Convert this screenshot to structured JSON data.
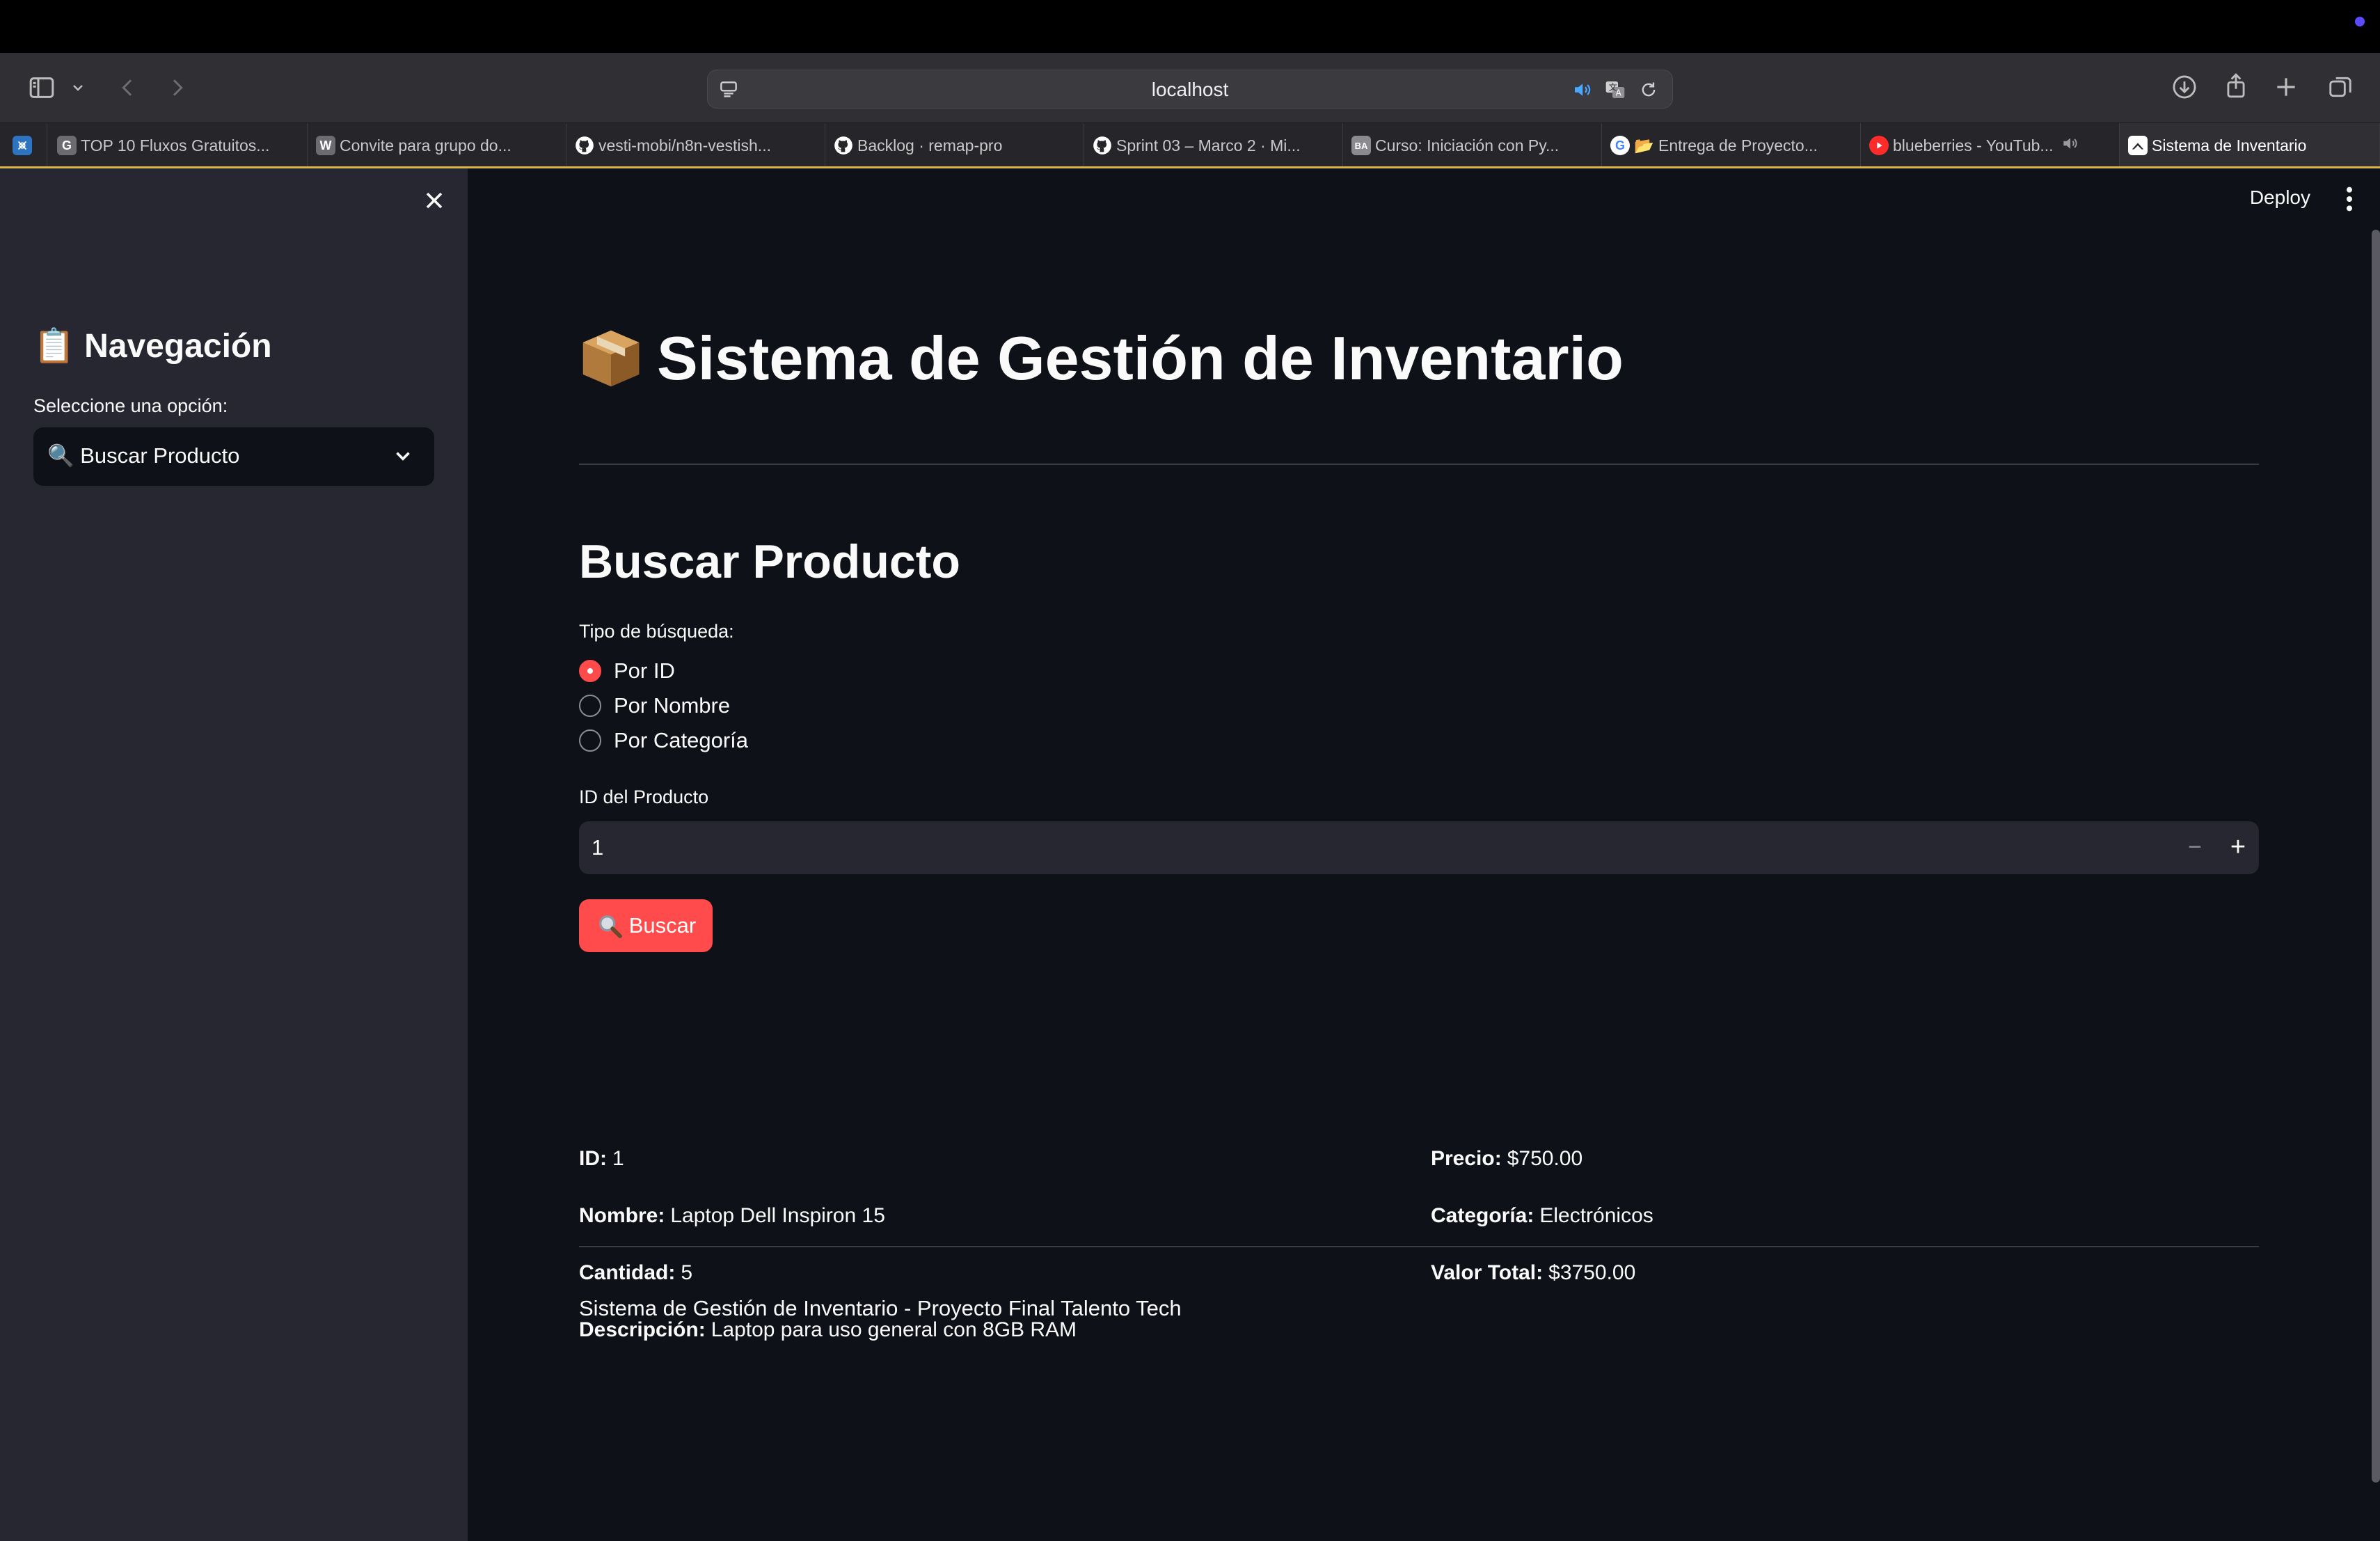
{
  "browser": {
    "url": "localhost",
    "tabs": [
      {
        "title": "TOP 10 Fluxos Gratuitos...",
        "favicon": "G",
        "color": "#6b6b70"
      },
      {
        "title": "Convite para grupo do...",
        "favicon": "W",
        "color": "#6b6b70"
      },
      {
        "title": "vesti-mobi/n8n-vestish...",
        "favicon": "github-icon",
        "color": "#ffffff"
      },
      {
        "title": "Backlog · remap-pro",
        "favicon": "github-icon",
        "color": "#ffffff"
      },
      {
        "title": "Sprint 03 – Marco 2 · Mi...",
        "favicon": "github-icon",
        "color": "#ffffff"
      },
      {
        "title": "Curso: Iniciación con Py...",
        "favicon": "BA",
        "color": "#8a8a8f"
      },
      {
        "title": "📂 Entrega de Proyecto...",
        "favicon": "G",
        "color": "#4285f4"
      },
      {
        "title": "blueberries - YouTub...",
        "favicon": "youtube-icon",
        "color": "#ff2b2b"
      },
      {
        "title": "Sistema de Inventario",
        "favicon": "streamlit-icon",
        "color": "#ffffff"
      }
    ]
  },
  "sidebar": {
    "heading": "📋 Navegación",
    "select_label": "Seleccione una opción:",
    "select_value": "🔍 Buscar Producto"
  },
  "header": {
    "deploy": "Deploy"
  },
  "main": {
    "title": "Sistema de Gestión de Inventario",
    "subtitle": "Buscar Producto",
    "search_type_label": "Tipo de búsqueda:",
    "radio_options": [
      "Por ID",
      "Por Nombre",
      "Por Categoría"
    ],
    "selected_option": "Por ID",
    "id_label": "ID del Producto",
    "id_value": "1",
    "search_button": "Buscar",
    "result": {
      "id_label": "ID:",
      "id_value": "1",
      "nombre_label": "Nombre:",
      "nombre_value": "Laptop Dell Inspiron 15",
      "cantidad_label": "Cantidad:",
      "cantidad_value": "5",
      "descripcion_label": "Descripción:",
      "descripcion_value": "Laptop para uso general con 8GB RAM",
      "precio_label": "Precio:",
      "precio_value": "$750.00",
      "categoria_label": "Categoría:",
      "categoria_value": "Electrónicos",
      "valor_label": "Valor Total:",
      "valor_value": "$3750.00"
    },
    "footer": "Sistema de Gestión de Inventario - Proyecto Final Talento Tech"
  },
  "colors": {
    "accent": "#ff4b4b",
    "background": "#0e1117",
    "sidebar": "#262730"
  }
}
